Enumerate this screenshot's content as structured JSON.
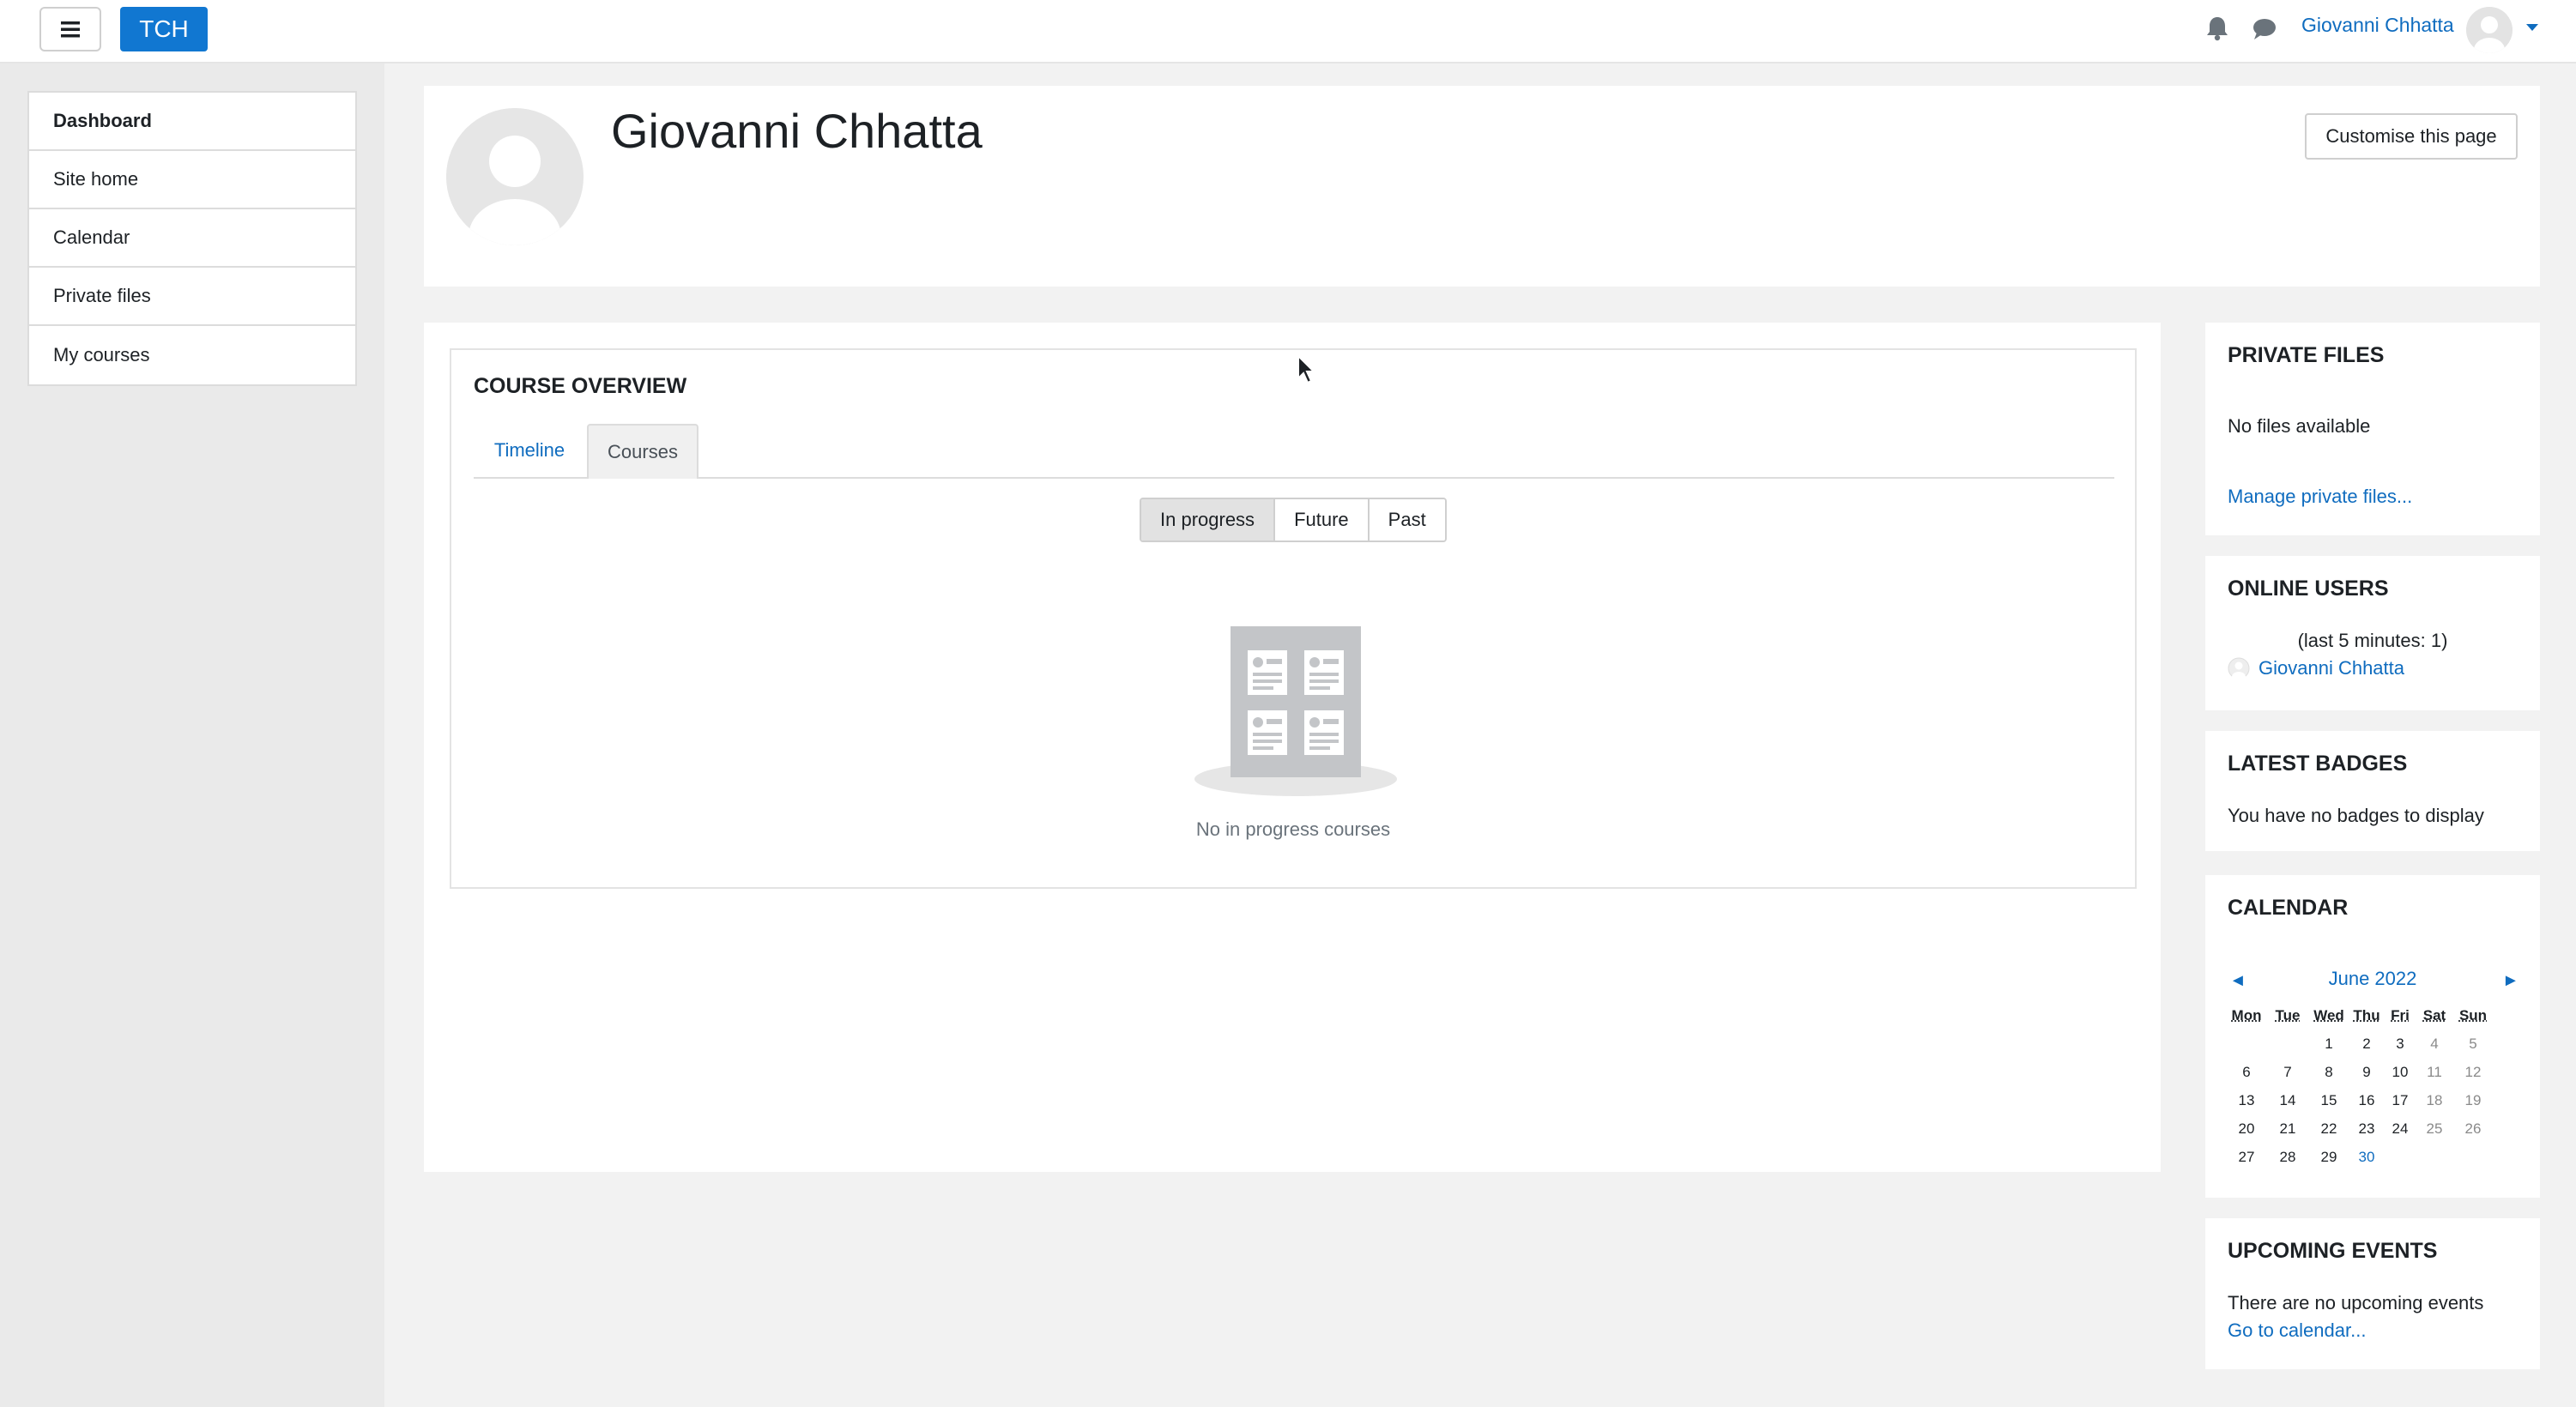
{
  "navbar": {
    "brand": "TCH",
    "user_name": "Giovanni Chhatta"
  },
  "drawer": {
    "items": [
      {
        "label": "Dashboard"
      },
      {
        "label": "Site home"
      },
      {
        "label": "Calendar"
      },
      {
        "label": "Private files"
      },
      {
        "label": "My courses"
      }
    ]
  },
  "header": {
    "name": "Giovanni Chhatta",
    "customise_label": "Customise this page"
  },
  "course_overview": {
    "title": "COURSE OVERVIEW",
    "tabs": [
      {
        "label": "Timeline"
      },
      {
        "label": "Courses"
      }
    ],
    "active_tab": "Courses",
    "filters": [
      {
        "label": "In progress"
      },
      {
        "label": "Future"
      },
      {
        "label": "Past"
      }
    ],
    "active_filter": "In progress",
    "empty_message": "No in progress courses"
  },
  "private_files": {
    "title": "PRIVATE FILES",
    "empty_text": "No files available",
    "manage_link": "Manage private files..."
  },
  "online_users": {
    "title": "ONLINE USERS",
    "summary": "(last 5 minutes: 1)",
    "users": [
      {
        "name": "Giovanni Chhatta"
      }
    ]
  },
  "latest_badges": {
    "title": "LATEST BADGES",
    "empty_text": "You have no badges to display"
  },
  "calendar": {
    "title": "CALENDAR",
    "month": "June 2022",
    "prev": "◄",
    "next": "►",
    "weekdays": [
      "Mon",
      "Tue",
      "Wed",
      "Thu",
      "Fri",
      "Sat",
      "Sun"
    ],
    "weeks": [
      [
        "",
        "",
        "1",
        "2",
        "3",
        "4",
        "5"
      ],
      [
        "6",
        "7",
        "8",
        "9",
        "10",
        "11",
        "12"
      ],
      [
        "13",
        "14",
        "15",
        "16",
        "17",
        "18",
        "19"
      ],
      [
        "20",
        "21",
        "22",
        "23",
        "24",
        "25",
        "26"
      ],
      [
        "27",
        "28",
        "29",
        "30",
        "",
        "",
        ""
      ]
    ],
    "today": "30"
  },
  "upcoming_events": {
    "title": "UPCOMING EVENTS",
    "empty_text": "There are no upcoming events",
    "calendar_link": "Go to calendar..."
  },
  "colors": {
    "accent": "#0f6cbf",
    "brand_bg": "#1177d1",
    "page_bg": "#f2f2f2"
  }
}
